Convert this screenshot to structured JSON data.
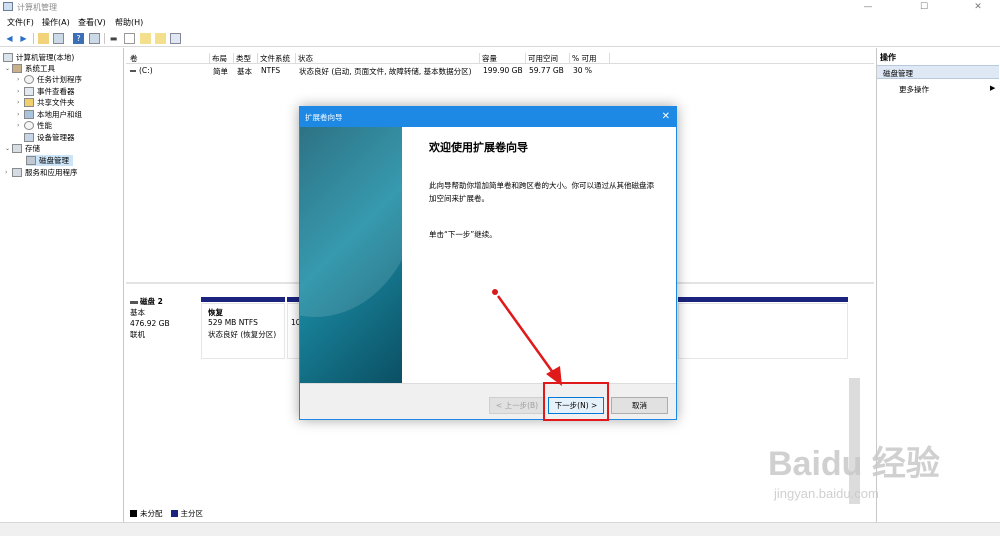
{
  "window": {
    "title": "计算机管理",
    "minimize": "—",
    "maximize": "☐",
    "close": "✕"
  },
  "menu": [
    "文件(F)",
    "操作(A)",
    "查看(V)",
    "帮助(H)"
  ],
  "toolbar": {
    "back_icon": "arrow-left",
    "forward_icon": "arrow-right"
  },
  "tree": {
    "root": "计算机管理(本地)",
    "system_tools": "系统工具",
    "task_scheduler": "任务计划程序",
    "event_viewer": "事件查看器",
    "shared_folders": "共享文件夹",
    "local_users": "本地用户和组",
    "performance": "性能",
    "device_manager": "设备管理器",
    "storage": "存储",
    "disk_management": "磁盘管理",
    "services": "服务和应用程序"
  },
  "volume_table": {
    "headers": [
      "卷",
      "布局",
      "类型",
      "文件系统",
      "状态",
      "容量",
      "可用空间",
      "% 可用"
    ],
    "rows": [
      {
        "volume": "(C:)",
        "layout": "简单",
        "type": "基本",
        "fs": "NTFS",
        "status": "状态良好 (启动, 页面文件, 故障转储, 基本数据分区)",
        "capacity": "199.90 GB",
        "free": "59.77 GB",
        "percent": "30 %"
      }
    ]
  },
  "disk": {
    "name": "磁盘 2",
    "type": "基本",
    "size": "476.92 GB",
    "state": "联机",
    "partition_recovery_name": "恢复",
    "partition_recovery_size": "529 MB NTFS",
    "partition_recovery_status": "状态良好 (恢复分区)",
    "partition_next_size": "10"
  },
  "legend": {
    "unallocated": "未分配",
    "primary": "主分区"
  },
  "actions": {
    "title": "操作",
    "section": "磁盘管理",
    "more": "更多操作"
  },
  "dialog": {
    "title": "扩展卷向导",
    "heading": "欢迎使用扩展卷向导",
    "description": "此向导帮助你增加简单卷和跨区卷的大小。你可以通过从其他磁盘添加空间来扩展卷。",
    "continue_hint": "单击“下一步”继续。",
    "back_button": "< 上一步(B)",
    "next_button": "下一步(N) >",
    "cancel_button": "取消"
  },
  "watermark": {
    "main": "Baidu 经验",
    "sub": "jingyan.baidu.com"
  },
  "colors": {
    "dialog_titlebar": "#1e88e5",
    "highlight": "#e01a1a",
    "primary_partition": "#1a237e",
    "selection": "#cce4f7"
  }
}
